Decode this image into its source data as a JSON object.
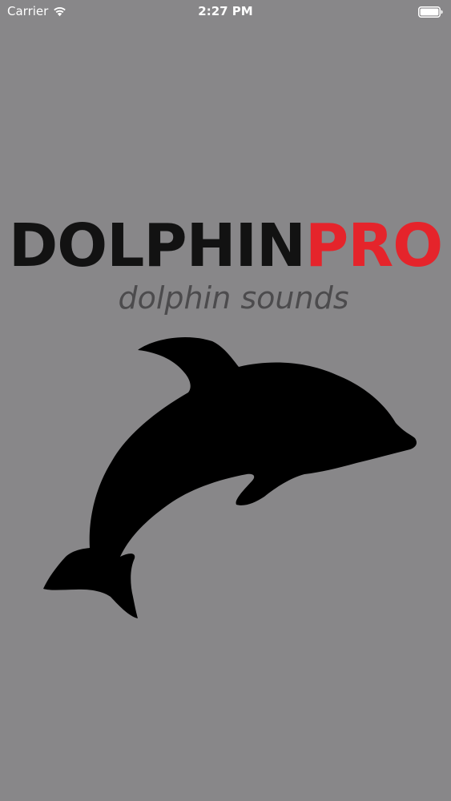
{
  "status_bar": {
    "carrier": "Carrier",
    "time": "2:27 PM",
    "wifi_icon": "wifi-icon",
    "battery_icon": "battery-full-icon"
  },
  "splash": {
    "title_part1": "DOLPHIN",
    "title_part2": "PRO",
    "subtitle": "dolphin sounds",
    "graphic": "dolphin-silhouette-icon"
  },
  "colors": {
    "background": "#888789",
    "title_dark": "#121212",
    "title_accent": "#e5242b",
    "subtitle": "#4c4b4d"
  }
}
